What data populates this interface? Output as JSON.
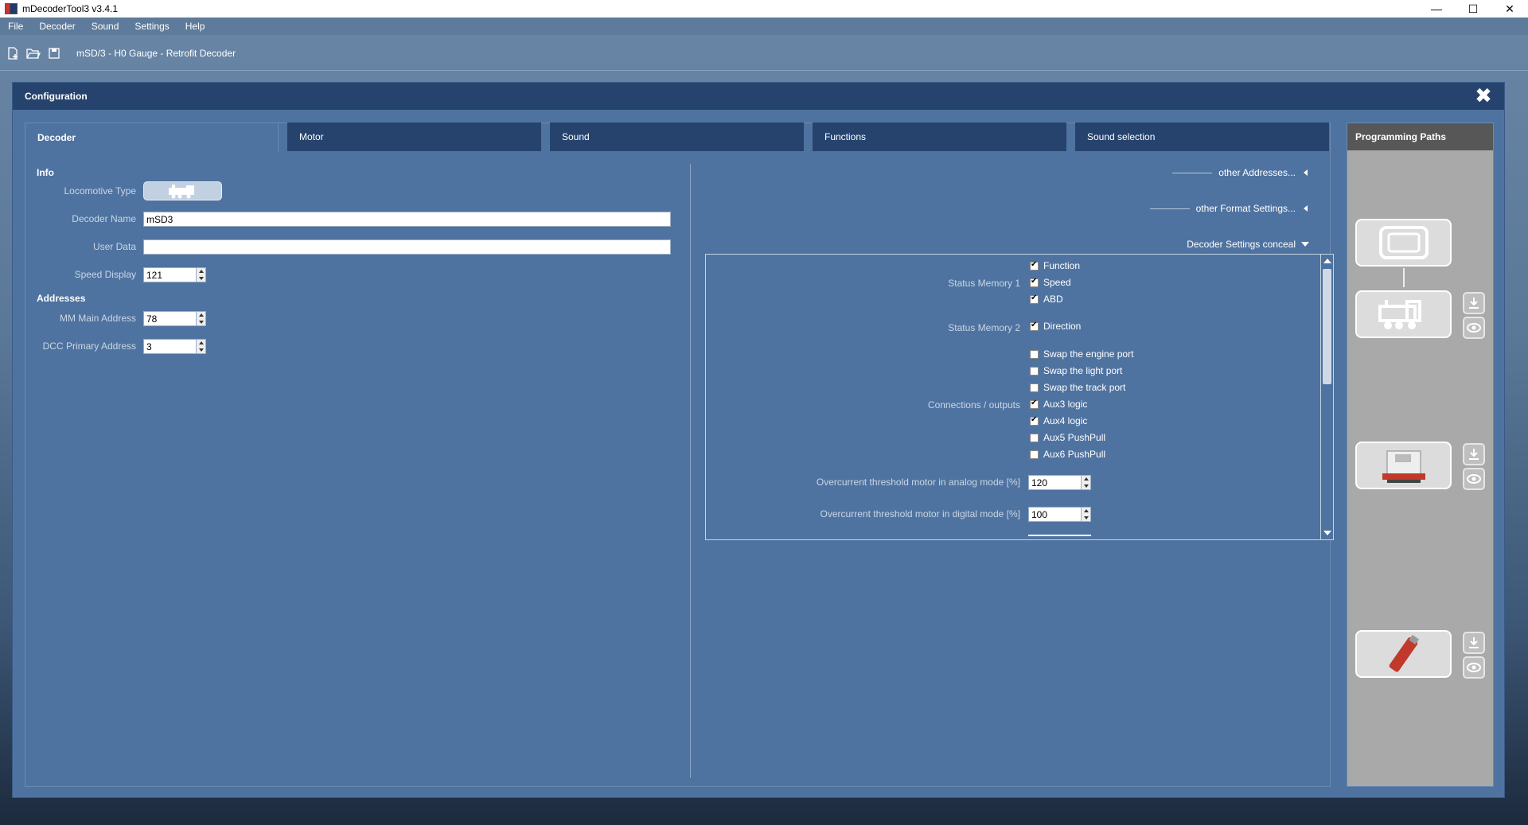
{
  "window": {
    "title": "mDecoderTool3  v3.4.1"
  },
  "menu": [
    "File",
    "Decoder",
    "Sound",
    "Settings",
    "Help"
  ],
  "toolbar": {
    "document_title": "mSD/3 - H0 Gauge - Retrofit Decoder"
  },
  "dialog": {
    "title": "Configuration"
  },
  "tabs": [
    "Decoder",
    "Motor",
    "Sound",
    "Functions",
    "Sound selection"
  ],
  "info": {
    "heading": "Info",
    "locomotive_type_label": "Locomotive Type",
    "decoder_name_label": "Decoder Name",
    "decoder_name_value": "mSD3",
    "user_data_label": "User Data",
    "user_data_value": "",
    "speed_display_label": "Speed Display",
    "speed_display_value": "121"
  },
  "addresses": {
    "heading": "Addresses",
    "mm_main_label": "MM Main Address",
    "mm_main_value": "78",
    "dcc_primary_label": "DCC Primary Address",
    "dcc_primary_value": "3"
  },
  "collapsers": {
    "other_addresses": "other Addresses...",
    "other_format": "other Format Settings...",
    "decoder_settings": "Decoder Settings conceal"
  },
  "settings": {
    "status_memory_1": {
      "label": "Status Memory 1",
      "items": [
        {
          "label": "Function",
          "checked": true
        },
        {
          "label": "Speed",
          "checked": true
        },
        {
          "label": "ABD",
          "checked": true
        }
      ]
    },
    "status_memory_2": {
      "label": "Status Memory 2",
      "items": [
        {
          "label": "Direction",
          "checked": true
        }
      ]
    },
    "connections": {
      "label": "Connections / outputs",
      "items": [
        {
          "label": "Swap the engine port",
          "checked": false
        },
        {
          "label": "Swap the light port",
          "checked": false
        },
        {
          "label": "Swap the track port",
          "checked": false
        },
        {
          "label": "Aux3 logic",
          "checked": true
        },
        {
          "label": "Aux4 logic",
          "checked": true
        },
        {
          "label": "Aux5 PushPull",
          "checked": false
        },
        {
          "label": "Aux6 PushPull",
          "checked": false
        }
      ]
    },
    "overcurrent_analog_label": "Overcurrent threshold motor in analog mode [%]",
    "overcurrent_analog_value": "120",
    "overcurrent_digital_label": "Overcurrent threshold motor in digital mode [%]",
    "overcurrent_digital_value": "100"
  },
  "programming_paths": {
    "title": "Programming Paths"
  }
}
